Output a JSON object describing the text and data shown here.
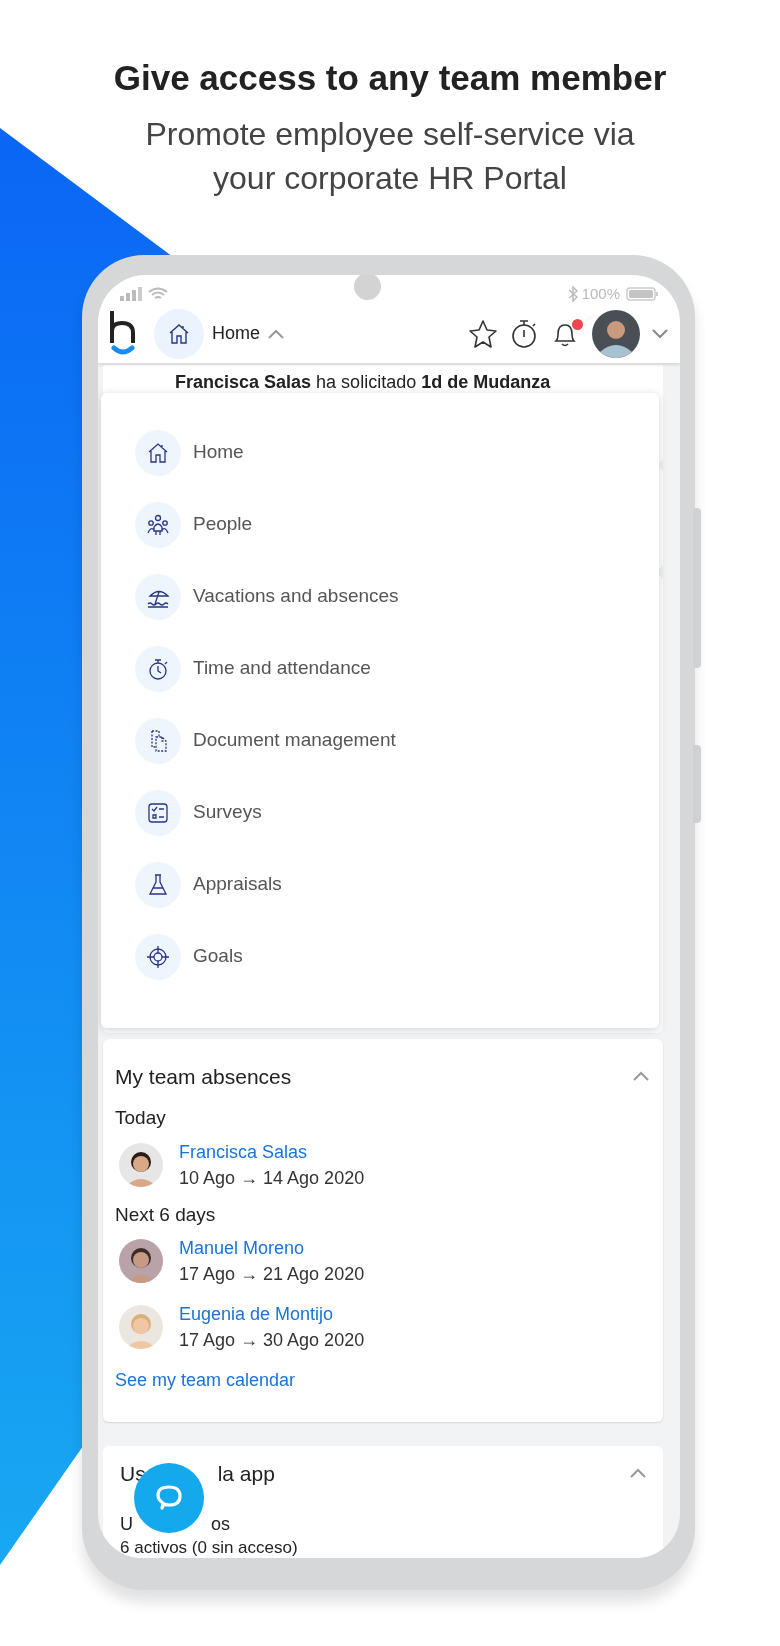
{
  "hero": {
    "title": "Give access to any team member",
    "subtitle": "Promote employee self-service via your corporate HR Portal"
  },
  "status_bar": {
    "battery": "100%"
  },
  "header": {
    "section": "Home",
    "expanded": true,
    "has_notification": true
  },
  "notification": {
    "text": "**Francisca Salas** ha solicitado **1d de Mudanza**"
  },
  "menu": [
    {
      "label": "Home",
      "kind": "home"
    },
    {
      "label": "People",
      "kind": "people"
    },
    {
      "label": "Vacations and absences",
      "kind": "beach"
    },
    {
      "label": "Time and attendance",
      "kind": "stopwatch"
    },
    {
      "label": "Document management",
      "kind": "documents"
    },
    {
      "label": "Surveys",
      "kind": "checklist"
    },
    {
      "label": "Appraisals",
      "kind": "flask"
    },
    {
      "label": "Goals",
      "kind": "target"
    }
  ],
  "team_absences": {
    "title": "My team absences",
    "expanded": true,
    "groups": [
      {
        "label": "Today",
        "people": [
          {
            "name": "Francisca Salas",
            "dates": "10 Ago → 14 Ago 2020"
          }
        ]
      },
      {
        "label": "Next 6 days",
        "people": [
          {
            "name": "Manuel Moreno",
            "dates": "17 Ago → 21 Ago 2020"
          },
          {
            "name": "Eugenia de Montijo",
            "dates": "17 Ago → 30 Ago 2020"
          }
        ]
      }
    ],
    "link": "See my team calendar"
  },
  "usage": {
    "title_start": "Us",
    "title_end": "la app",
    "expanded": true,
    "stat_label_start": "U",
    "stat_label_end": "os",
    "stat_value": "6 activos (0 sin acceso)"
  }
}
